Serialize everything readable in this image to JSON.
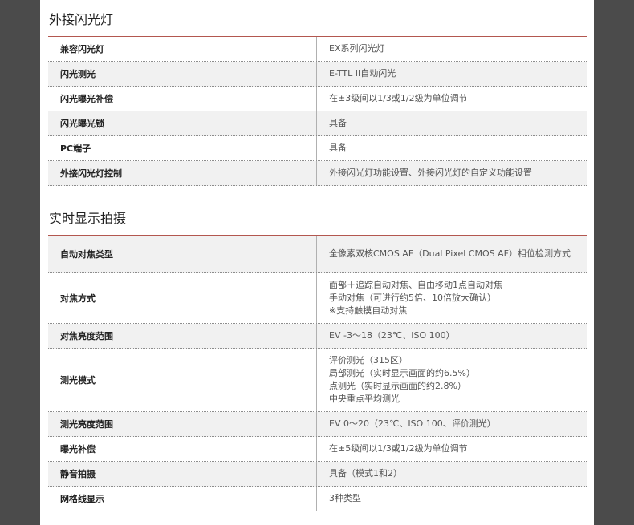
{
  "sections": [
    {
      "title": "外接闪光灯",
      "rows": [
        {
          "label": "兼容闪光灯",
          "lines": [
            "EX系列闪光灯"
          ]
        },
        {
          "label": "闪光测光",
          "lines": [
            "E-TTL II自动闪光"
          ]
        },
        {
          "label": "闪光曝光补偿",
          "lines": [
            "在±3级间以1/3或1/2级为单位调节"
          ]
        },
        {
          "label": "闪光曝光锁",
          "lines": [
            "具备"
          ]
        },
        {
          "label": "PC端子",
          "lines": [
            "具备"
          ]
        },
        {
          "label": "外接闪光灯控制",
          "lines": [
            "外接闪光灯功能设置、外接闪光灯的自定义功能设置"
          ]
        }
      ]
    },
    {
      "title": "实时显示拍摄",
      "rows": [
        {
          "label": "自动对焦类型",
          "lines": [
            "全像素双核CMOS AF（Dual Pixel CMOS AF）相位检测方式"
          ]
        },
        {
          "label": "对焦方式",
          "lines": [
            "面部＋追踪自动对焦、自由移动1点自动对焦",
            "手动对焦（可进行约5倍、10倍放大确认）",
            "※支持触摸自动对焦"
          ]
        },
        {
          "label": "对焦亮度范围",
          "lines": [
            "EV -3～18（23℃、ISO 100）"
          ]
        },
        {
          "label": "测光模式",
          "lines": [
            "评价测光（315区）",
            "局部测光（实时显示画面的约6.5%）",
            "点测光（实时显示画面的约2.8%）",
            "中央重点平均测光"
          ]
        },
        {
          "label": "测光亮度范围",
          "lines": [
            "EV 0～20（23℃、ISO 100、评价测光）"
          ]
        },
        {
          "label": "曝光补偿",
          "lines": [
            "在±5级间以1/3或1/2级为单位调节"
          ]
        },
        {
          "label": "静音拍摄",
          "lines": [
            "具备（模式1和2）"
          ]
        },
        {
          "label": "网格线显示",
          "lines": [
            "3种类型"
          ]
        }
      ]
    }
  ]
}
